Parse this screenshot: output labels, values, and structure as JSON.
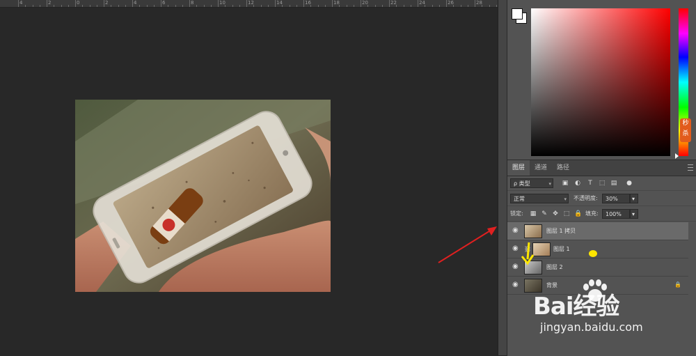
{
  "ruler": {
    "labels": [
      "4",
      "2",
      "0",
      "2",
      "4",
      "6",
      "8",
      "10",
      "12",
      "14",
      "16",
      "18",
      "20",
      "22",
      "24",
      "26",
      "28"
    ]
  },
  "side_badge": {
    "text": "秒杀"
  },
  "layers_panel": {
    "tabs": [
      {
        "label": "图层",
        "active": true
      },
      {
        "label": "通道",
        "active": false
      },
      {
        "label": "路径",
        "active": false
      }
    ],
    "filter": {
      "prefix": "ρ",
      "type_label": "类型"
    },
    "blend_mode": "正常",
    "opacity_label": "不透明度:",
    "opacity_value": "30%",
    "lock_label": "锁定:",
    "fill_label": "填充:",
    "fill_value": "100%",
    "layers": [
      {
        "name": "图层 1 拷贝",
        "selected": true,
        "visible": true
      },
      {
        "name": "图层 1",
        "selected": false,
        "visible": true
      },
      {
        "name": "图层 2",
        "selected": false,
        "visible": true
      },
      {
        "name": "背景",
        "selected": false,
        "visible": true,
        "locked": true
      }
    ]
  },
  "watermark": {
    "brand": "Bai经验",
    "url": "jingyan.baidu.com"
  },
  "colors": {
    "panel_bg": "#535353",
    "selected_row": "#6a6a6a",
    "annotation_red": "#e02020",
    "annotation_yellow": "#ffe600"
  },
  "icons": [
    "eye-icon",
    "lock-icon",
    "filter-pixel-icon",
    "filter-adjust-icon",
    "filter-type-icon",
    "filter-shape-icon",
    "filter-smart-icon",
    "panel-menu-icon",
    "link-icon"
  ]
}
